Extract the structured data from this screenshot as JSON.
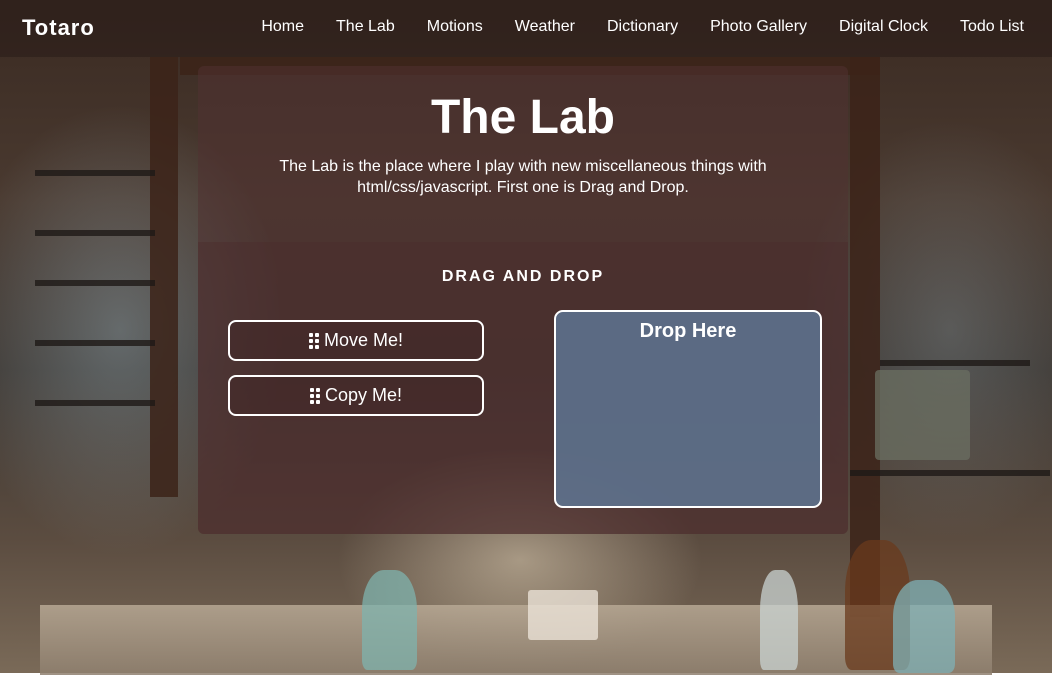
{
  "nav": {
    "brand": "Totaro",
    "links": [
      "Home",
      "The Lab",
      "Motions",
      "Weather",
      "Dictionary",
      "Photo Gallery",
      "Digital Clock",
      "Todo List"
    ]
  },
  "hero": {
    "title": "The Lab",
    "subtitle": "The Lab is the place where I play with new miscellaneous things with html/css/javascript. First one is Drag and Drop."
  },
  "drag_drop": {
    "heading": "DRAG AND DROP",
    "items": [
      "Move Me!",
      "Copy Me!"
    ],
    "drop_zone_label": "Drop Here"
  },
  "colors": {
    "drop_zone": "#5f7896",
    "panel": "#503232"
  },
  "icons": {
    "drag_handle": "grip-vertical-icon"
  }
}
